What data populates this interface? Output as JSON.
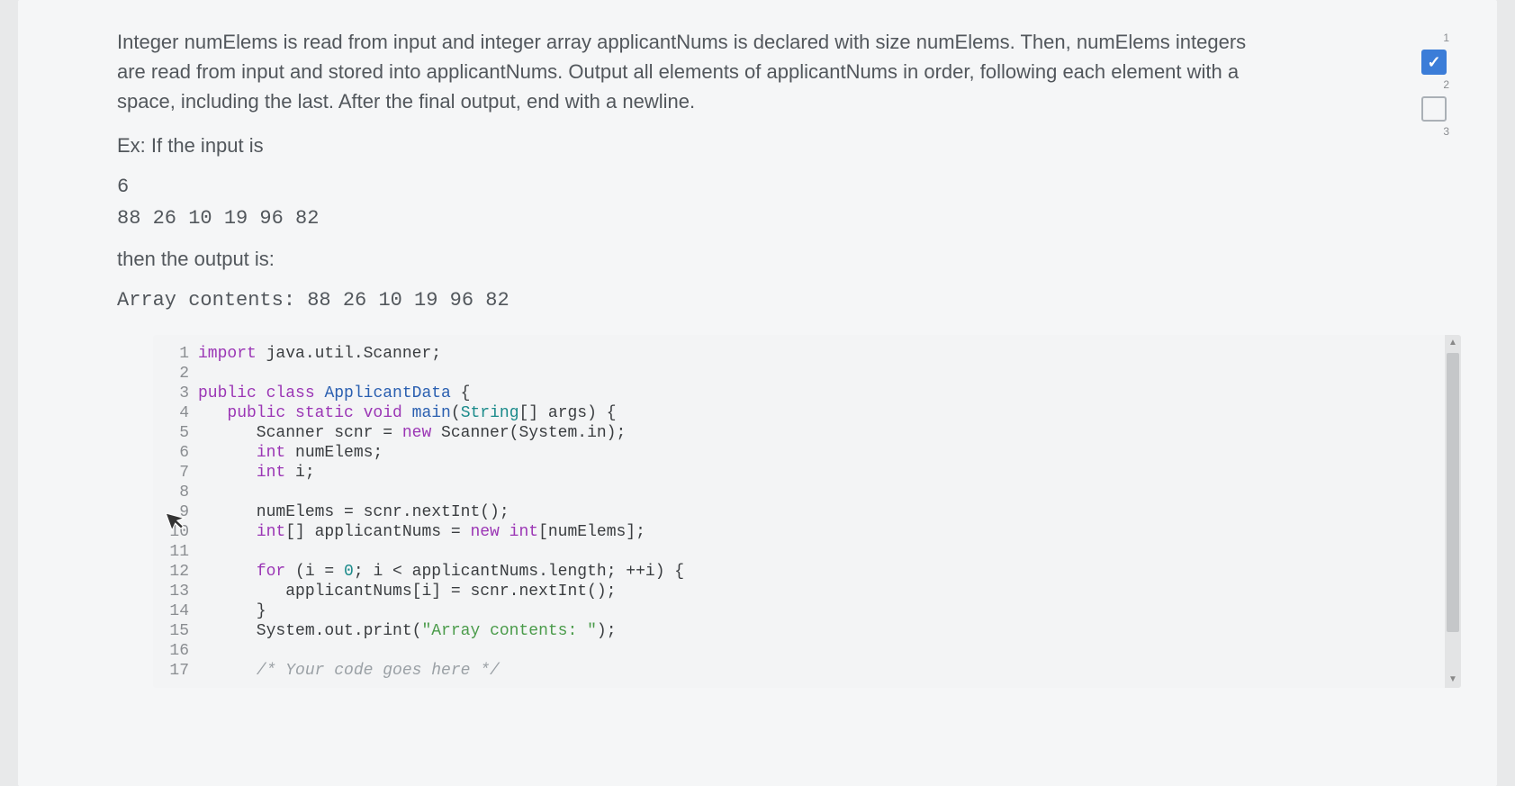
{
  "problem": {
    "description": "Integer numElems is read from input and integer array applicantNums is declared with size numElems. Then, numElems integers are read from input and stored into applicantNums. Output all elements of applicantNums in order, following each element with a space, including the last. After the final output, end with a newline.",
    "example_prefix": "Ex: If the input is",
    "input_line1": "6",
    "input_line2": "88 26 10 19 96 82",
    "output_label": "then the output is:",
    "output_line": "Array contents: 88 26 10 19 96 82"
  },
  "code": {
    "lines": [
      {
        "n": "1",
        "parts": [
          {
            "t": "import",
            "c": "kw-purple"
          },
          {
            "t": " java.util.Scanner;"
          }
        ]
      },
      {
        "n": "2",
        "parts": []
      },
      {
        "n": "3",
        "parts": [
          {
            "t": "public class",
            "c": "kw-purple"
          },
          {
            "t": " "
          },
          {
            "t": "ApplicantData",
            "c": "kw-blue"
          },
          {
            "t": " {"
          }
        ]
      },
      {
        "n": "4",
        "parts": [
          {
            "t": "   "
          },
          {
            "t": "public static void",
            "c": "kw-purple"
          },
          {
            "t": " "
          },
          {
            "t": "main",
            "c": "kw-blue"
          },
          {
            "t": "("
          },
          {
            "t": "String",
            "c": "kw-teal"
          },
          {
            "t": "[] args) {"
          }
        ]
      },
      {
        "n": "5",
        "parts": [
          {
            "t": "      Scanner scnr = "
          },
          {
            "t": "new",
            "c": "kw-purple"
          },
          {
            "t": " Scanner(System.in);"
          }
        ]
      },
      {
        "n": "6",
        "parts": [
          {
            "t": "      "
          },
          {
            "t": "int",
            "c": "kw-purple"
          },
          {
            "t": " numElems;"
          }
        ]
      },
      {
        "n": "7",
        "parts": [
          {
            "t": "      "
          },
          {
            "t": "int",
            "c": "kw-purple"
          },
          {
            "t": " i;"
          }
        ]
      },
      {
        "n": "8",
        "parts": []
      },
      {
        "n": "9",
        "parts": [
          {
            "t": "      numElems = scnr.nextInt();"
          }
        ]
      },
      {
        "n": "10",
        "parts": [
          {
            "t": "      "
          },
          {
            "t": "int",
            "c": "kw-purple"
          },
          {
            "t": "[] applicantNums = "
          },
          {
            "t": "new",
            "c": "kw-purple"
          },
          {
            "t": " "
          },
          {
            "t": "int",
            "c": "kw-purple"
          },
          {
            "t": "[numElems];"
          }
        ]
      },
      {
        "n": "11",
        "parts": []
      },
      {
        "n": "12",
        "parts": [
          {
            "t": "      "
          },
          {
            "t": "for",
            "c": "kw-purple"
          },
          {
            "t": " (i = "
          },
          {
            "t": "0",
            "c": "kw-teal"
          },
          {
            "t": "; i < applicantNums.length; ++i) {"
          }
        ]
      },
      {
        "n": "13",
        "parts": [
          {
            "t": "         applicantNums[i] = scnr.nextInt();"
          }
        ]
      },
      {
        "n": "14",
        "parts": [
          {
            "t": "      }"
          }
        ]
      },
      {
        "n": "15",
        "parts": [
          {
            "t": "      System.out.print("
          },
          {
            "t": "\"Array contents: \"",
            "c": "str-green"
          },
          {
            "t": ");"
          }
        ]
      },
      {
        "n": "16",
        "parts": []
      },
      {
        "n": "17",
        "parts": [
          {
            "t": "      "
          },
          {
            "t": "/* Your code goes here */",
            "c": "comment-gray"
          }
        ]
      }
    ]
  },
  "progress": {
    "step1_num": "1",
    "step2_num": "2",
    "step3_num": "3",
    "step1_checked": true,
    "step2_checked": false
  }
}
